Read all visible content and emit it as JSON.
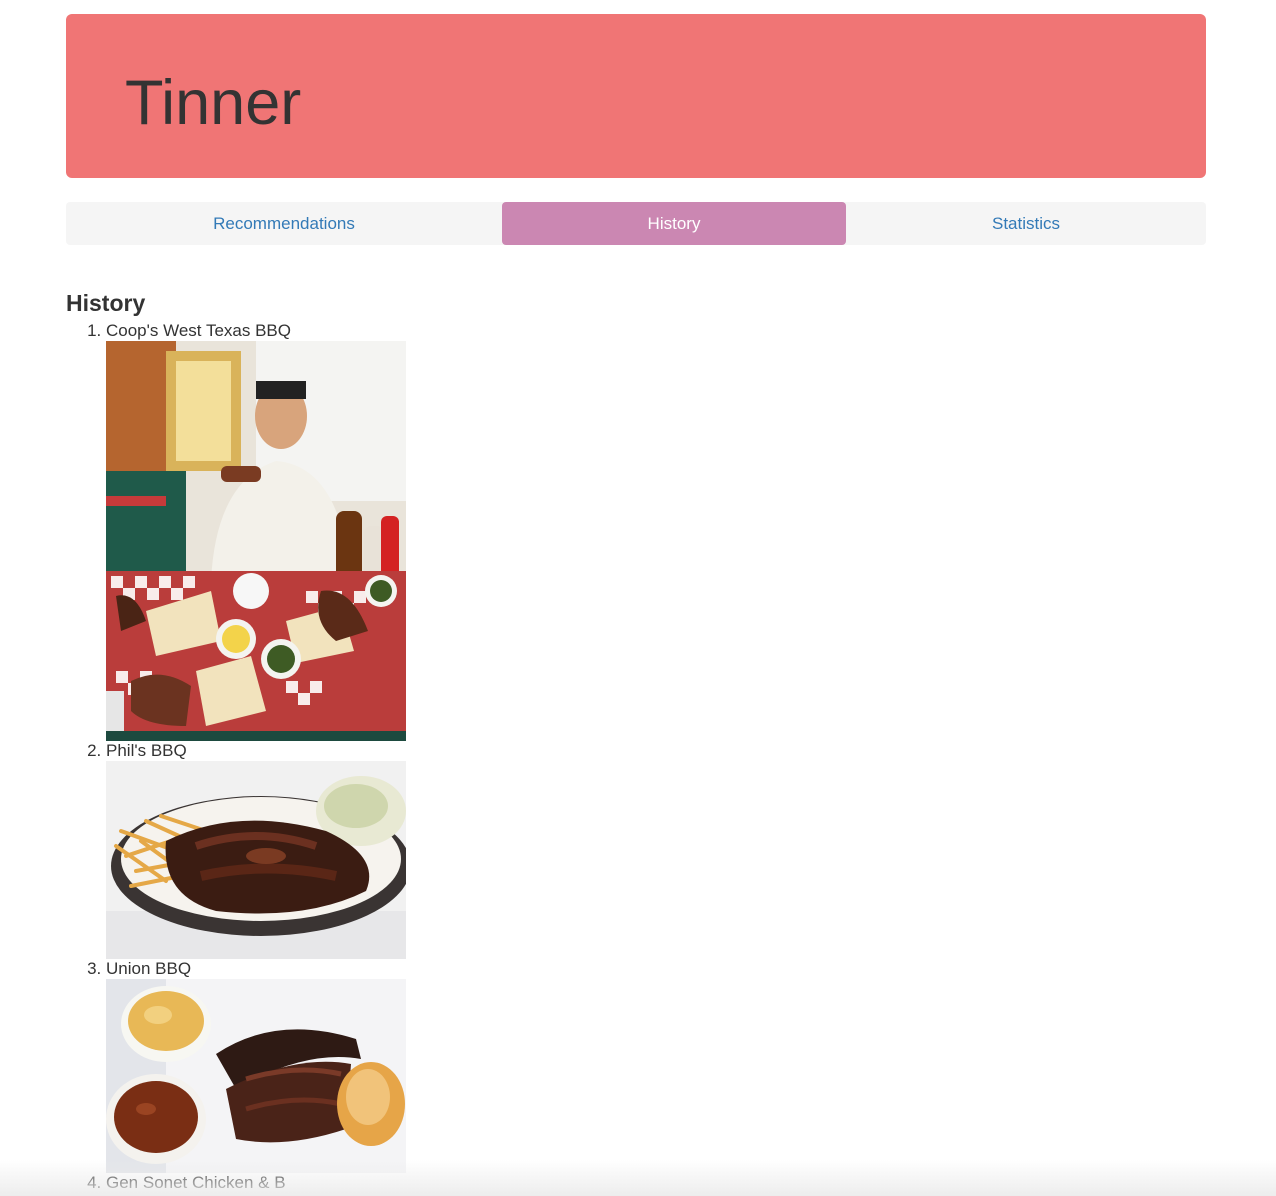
{
  "header": {
    "title": "Tinner",
    "background_color": "#f07575"
  },
  "nav": {
    "tabs": [
      {
        "label": "Recommendations",
        "active": false
      },
      {
        "label": "History",
        "active": true
      },
      {
        "label": "Statistics",
        "active": false
      }
    ],
    "active_color": "#cb87b2",
    "link_color": "#337ab7"
  },
  "history": {
    "heading": "History",
    "items": [
      {
        "name": "Coop's West Texas BBQ",
        "image": "bbq-table-photo"
      },
      {
        "name": "Phil's BBQ",
        "image": "ribs-fries-slaw-photo"
      },
      {
        "name": "Union BBQ",
        "image": "brisket-mac-beans-photo"
      },
      {
        "name": "Gen Sonet Chicken & B",
        "image": ""
      }
    ]
  }
}
